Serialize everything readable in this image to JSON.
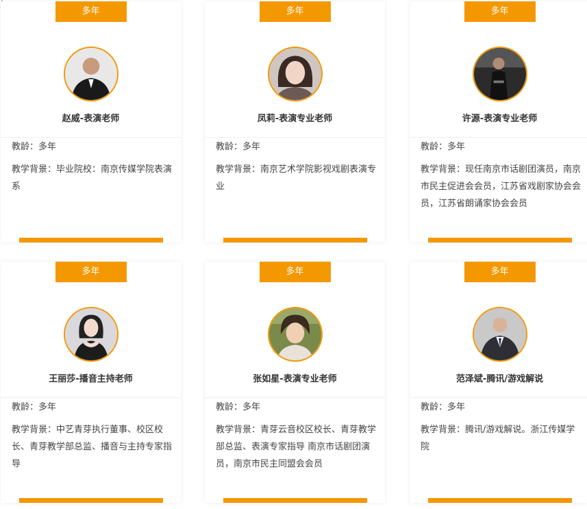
{
  "colors": {
    "accent": "#f39800",
    "text": "#333333",
    "divider": "#eeeeee"
  },
  "cards": [
    {
      "tag": "多年",
      "name": "赵威-表演老师",
      "age_label": "教龄：多年",
      "background": "教学背景：毕业院校：南京传媒学院表演系",
      "avatar_icon": "teacher-photo"
    },
    {
      "tag": "多年",
      "name": "凤莉-表演专业老师",
      "age_label": "教龄：多年",
      "background": "教学背景：南京艺术学院影视戏剧表演专业",
      "avatar_icon": "teacher-photo"
    },
    {
      "tag": "多年",
      "name": "许源-表演专业老师",
      "age_label": "教龄：多年",
      "background": "教学背景：现任南京市话剧团演员，南京市民主促进会会员，江苏省戏剧家协会会员，江苏省朗诵家协会会员",
      "avatar_icon": "teacher-photo"
    },
    {
      "tag": "多年",
      "name": "王丽莎-播音主持老师",
      "age_label": "教龄：多年",
      "background": "教学背景：中艺青芽执行董事、校区校长、青芽教学部总监、播音与主持专家指导",
      "avatar_icon": "teacher-photo"
    },
    {
      "tag": "多年",
      "name": "张如星-表演专业老师",
      "age_label": "教龄：多年",
      "background": "教学背景：青芽云音校区校长、青芽教学部总监、表演专家指导 南京市话剧团演员，南京市民主同盟会会员",
      "avatar_icon": "teacher-photo"
    },
    {
      "tag": "多年",
      "name": "范泽斌-腾讯/游戏解说",
      "age_label": "教龄：多年",
      "background": "教学背景：腾讯/游戏解说。浙江传媒学院",
      "avatar_icon": "teacher-photo"
    }
  ]
}
